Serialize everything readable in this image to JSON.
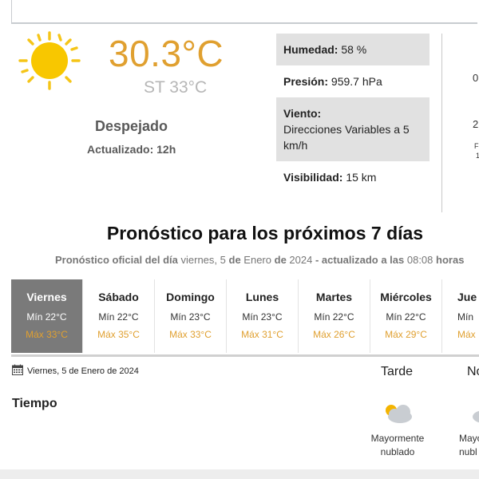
{
  "current": {
    "temperature": "30.3°C",
    "feels_like": "ST 33°C",
    "condition": "Despejado",
    "updated": "Actualizado: 12h",
    "icon": "sun-icon",
    "temp_color": "#e0a030"
  },
  "details": {
    "humidity_label": "Humedad:",
    "humidity_value": "58 %",
    "pressure_label": "Presión:",
    "pressure_value": "959.7 hPa",
    "wind_label": "Viento:",
    "wind_value": "Direcciones Variables a 5 km/h",
    "visibility_label": "Visibilidad:",
    "visibility_value": "15 km"
  },
  "side_fragments": [
    "0",
    "2",
    "F",
    "1"
  ],
  "forecast": {
    "title": "Pronóstico para los próximos 7 días",
    "sub_official": "Pronóstico oficial del día",
    "sub_date_a": "viernes, 5",
    "sub_de1": "de",
    "sub_date_b": "Enero",
    "sub_de2": "de",
    "sub_date_c": "2024",
    "sub_updated": "- actualizado a las",
    "sub_time": "08:08",
    "sub_hours": "horas"
  },
  "days": [
    {
      "name": "Viernes",
      "min": "Mín 22°C",
      "max": "Máx 33°C",
      "selected": true
    },
    {
      "name": "Sábado",
      "min": "Mín 22°C",
      "max": "Máx 35°C"
    },
    {
      "name": "Domingo",
      "min": "Mín 23°C",
      "max": "Máx 33°C"
    },
    {
      "name": "Lunes",
      "min": "Mín 23°C",
      "max": "Máx 31°C"
    },
    {
      "name": "Martes",
      "min": "Mín 22°C",
      "max": "Máx 26°C"
    },
    {
      "name": "Miércoles",
      "min": "Mín 22°C",
      "max": "Máx 29°C"
    },
    {
      "name": "Jue",
      "min": "Mín",
      "max": "Máx"
    }
  ],
  "detail_day": {
    "date": "Viernes, 5 de Enero de 2024",
    "tarde": "Tarde",
    "noche": "No",
    "tiempo": "Tiempo",
    "tarde_desc_1": "Mayormente",
    "tarde_desc_2": "nublado",
    "noche_desc_1": "Mayo",
    "noche_desc_2": "nubl"
  }
}
